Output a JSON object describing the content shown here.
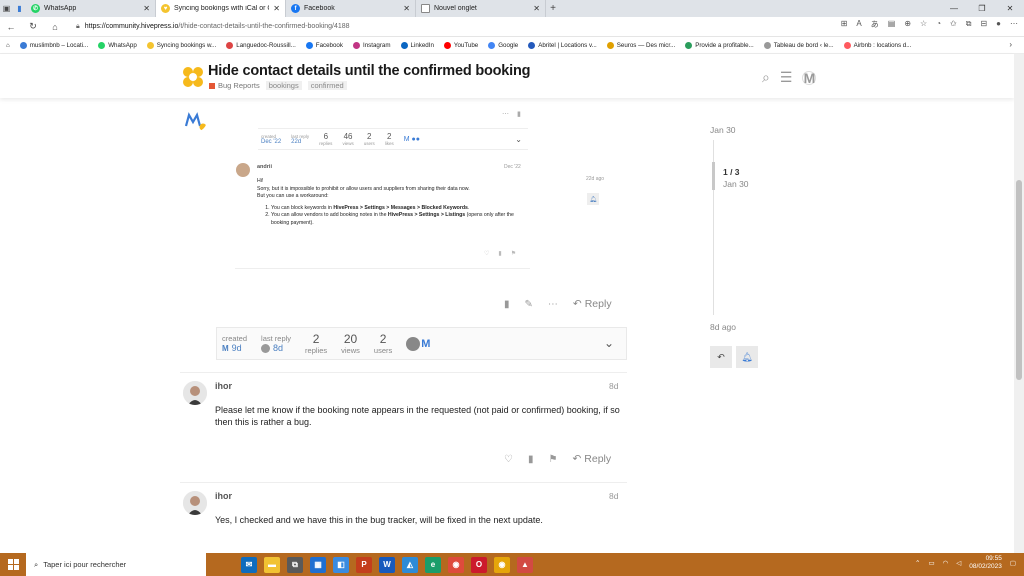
{
  "browser": {
    "tabs": [
      {
        "title": "WhatsApp",
        "icon": "whatsapp-icon",
        "color": "#25d366"
      },
      {
        "title": "Syncing bookings with iCal or Go",
        "icon": "hivepress-icon",
        "color": "#f4c430"
      },
      {
        "title": "Facebook",
        "icon": "facebook-icon",
        "color": "#1877f2"
      },
      {
        "title": "Nouvel onglet",
        "icon": "newtab-icon",
        "color": "#888888"
      }
    ],
    "url_host": "https://community.hivepress.io",
    "url_path": "/t/hide-contact-details-until-the-confirmed-booking/4188",
    "bookmarks": [
      {
        "label": "muslimbnb – Locati...",
        "color": "#3a7bd5"
      },
      {
        "label": "WhatsApp",
        "color": "#25d366"
      },
      {
        "label": "Syncing bookings w...",
        "color": "#f4c430"
      },
      {
        "label": "Languedoc-Roussill...",
        "color": "#d44"
      },
      {
        "label": "Facebook",
        "color": "#1877f2"
      },
      {
        "label": "Instagram",
        "color": "#c13584"
      },
      {
        "label": "LinkedIn",
        "color": "#0a66c2"
      },
      {
        "label": "YouTube",
        "color": "#ff0000"
      },
      {
        "label": "Google",
        "color": "#4285f4"
      },
      {
        "label": "Abritel | Locations v...",
        "color": "#245abc"
      },
      {
        "label": "Seuros — Des micr...",
        "color": "#e0a000"
      },
      {
        "label": "Provide a profitable...",
        "color": "#2a9d5c"
      },
      {
        "label": "Tableau de bord ‹ le...",
        "color": "#999999"
      },
      {
        "label": "Airbnb : locations d...",
        "color": "#ff5a5f"
      }
    ]
  },
  "topic": {
    "title": "Hide contact details until the confirmed booking",
    "category": "Bug Reports",
    "tags": [
      "bookings",
      "confirmed"
    ]
  },
  "embedded": {
    "created_label": "created",
    "created_date": "Dec '22",
    "last_reply_label": "last reply",
    "last_reply_date": "22d",
    "replies": "6",
    "replies_label": "replies",
    "views": "46",
    "views_label": "views",
    "users": "2",
    "users_label": "users",
    "likes": "2",
    "likes_label": "likes",
    "author": "andrii",
    "date": "Dec '22",
    "greeting": "Hi!",
    "line1": "Sorry, but it is impossible to prohibit or allow users and suppliers from sharing their data now.",
    "line2": "But you can use a workaround:",
    "item1_pre": "You can block keywords in ",
    "item1_bold": "HivePress > Settings > Messages > Blocked Keywords",
    "item1_post": ".",
    "item2_pre": "You can allow vendors to add booking notes in the ",
    "item2_bold": "HivePress > Settings > Listings",
    "item2_post": " (opens only after the booking payment).",
    "side_ago": "22d ago"
  },
  "main_post": {
    "reply_label": "Reply"
  },
  "topic_map": {
    "created_label": "created",
    "created_value": "9d",
    "last_reply_label": "last reply",
    "last_reply_value": "8d",
    "replies": "2",
    "replies_label": "replies",
    "views": "20",
    "views_label": "views",
    "users": "2",
    "users_label": "users"
  },
  "posts": [
    {
      "username": "ihor",
      "date": "8d",
      "body": "Please let me know if the booking note appears in the requested (not paid or confirmed) booking, if so then this is rather a bug.",
      "reply_label": "Reply"
    },
    {
      "username": "ihor",
      "date": "8d",
      "body": "Yes, I checked and we have this in the bug tracker, will be fixed in the next update."
    }
  ],
  "timeline": {
    "top_date": "Jan 30",
    "count": "1 / 3",
    "current_date": "Jan 30",
    "bottom": "8d ago"
  },
  "taskbar": {
    "search_placeholder": "Taper ici pour rechercher",
    "time": "09:55",
    "date": "08/02/2023"
  }
}
